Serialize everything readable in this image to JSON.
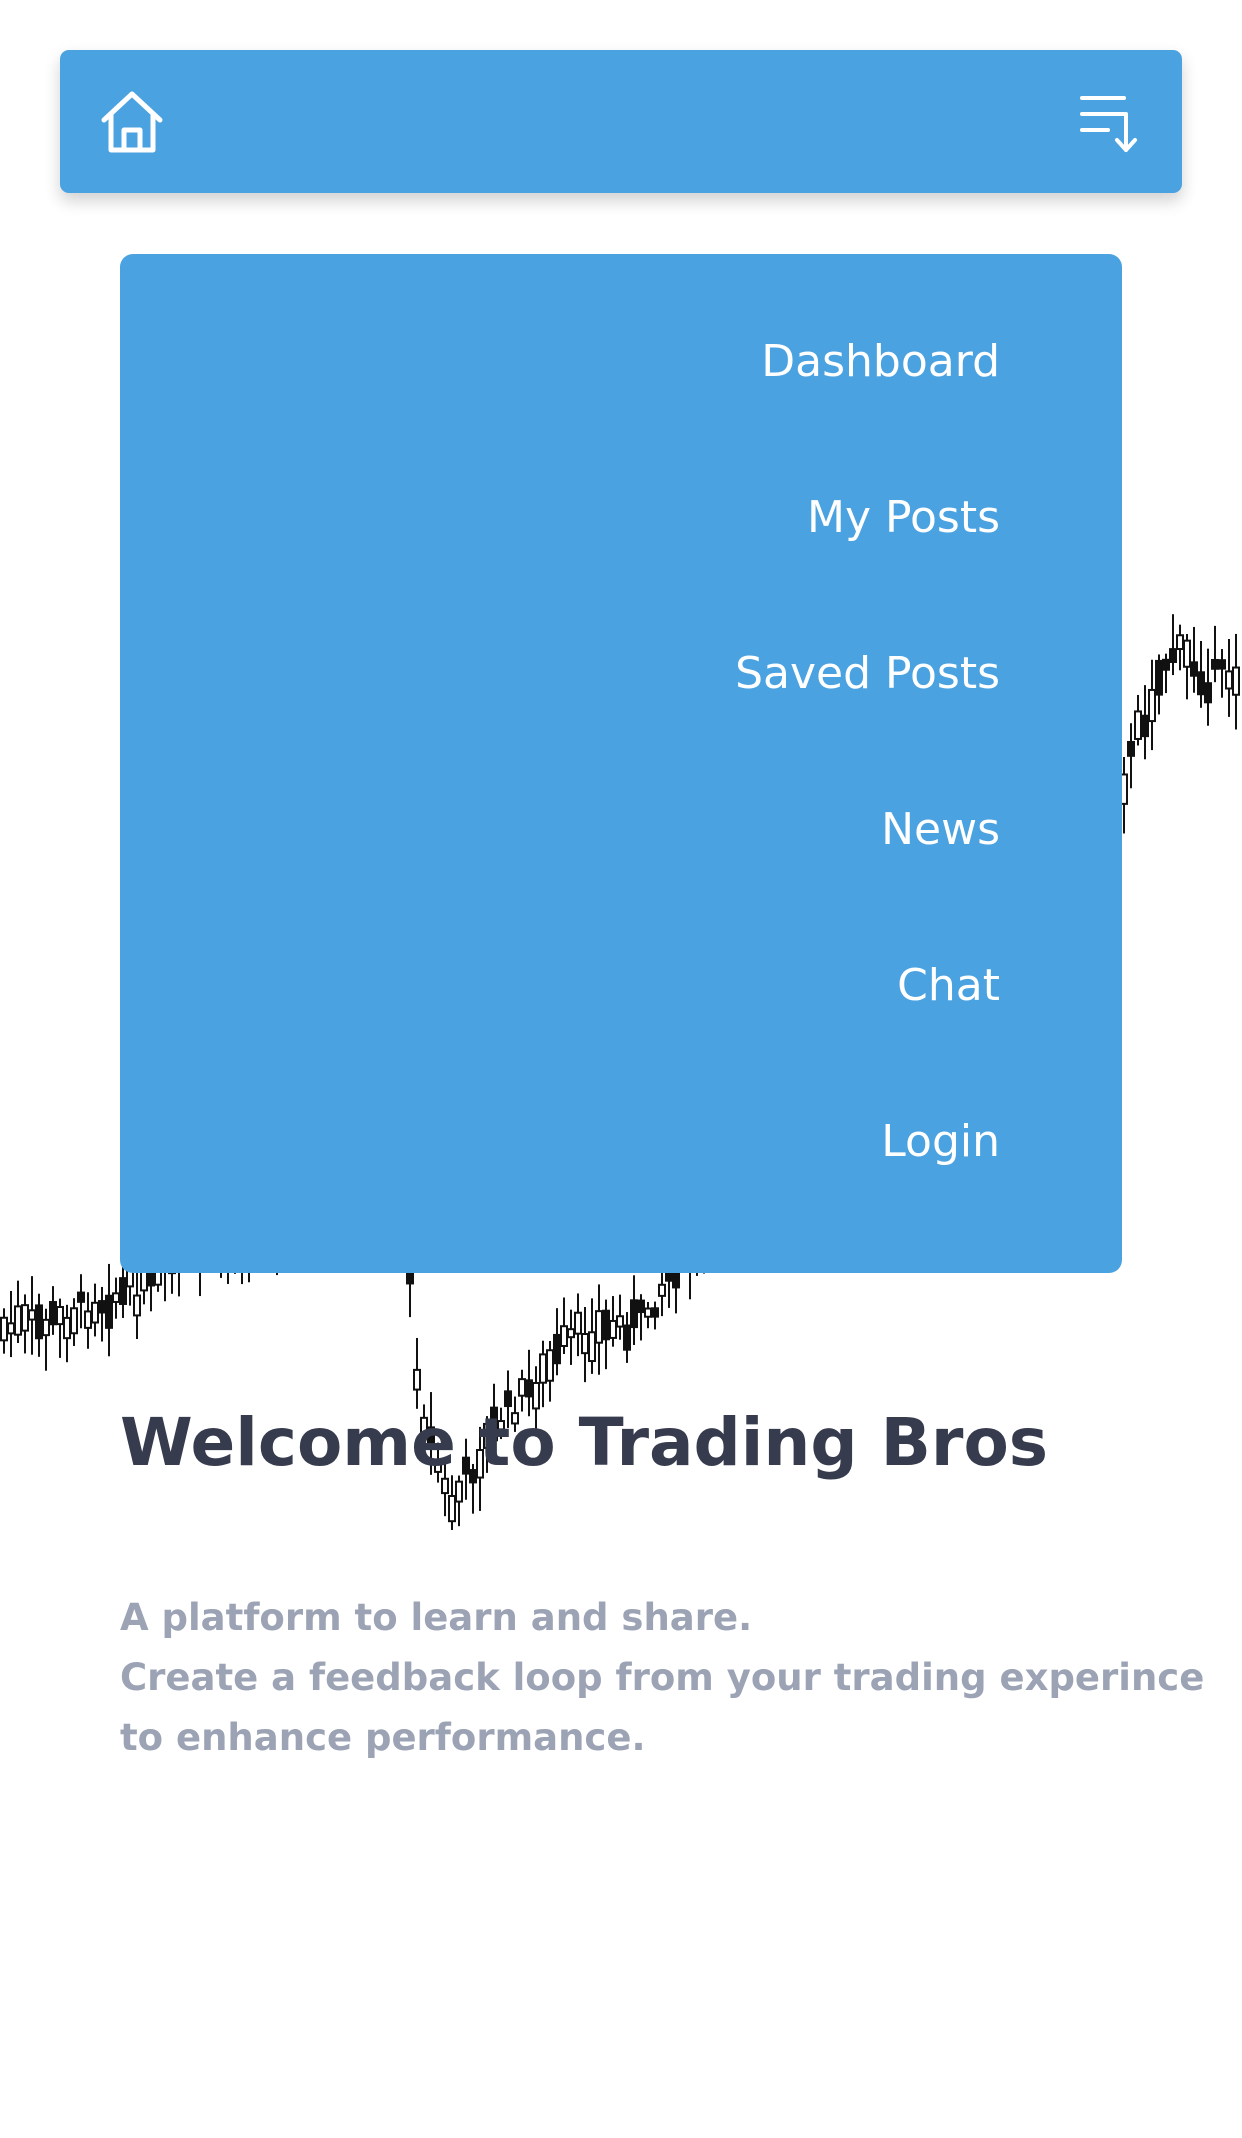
{
  "navbar": {
    "home_icon": "home-icon",
    "menu_icon": "sort-descending-icon",
    "color": "#4ba2e1"
  },
  "menu": {
    "items": [
      {
        "label": "Dashboard"
      },
      {
        "label": "My Posts"
      },
      {
        "label": "Saved Posts"
      },
      {
        "label": "News"
      },
      {
        "label": "Chat"
      },
      {
        "label": "Login"
      }
    ]
  },
  "hero": {
    "title": "Welcome to Trading Bros",
    "subtitle_lines": [
      "A platform to learn and share.",
      "Create a feedback loop from your trading experince",
      "to enhance performance."
    ]
  },
  "colors": {
    "accent": "#4ba2e1",
    "title": "#363b4d",
    "subtitle": "#9ba3b4"
  }
}
